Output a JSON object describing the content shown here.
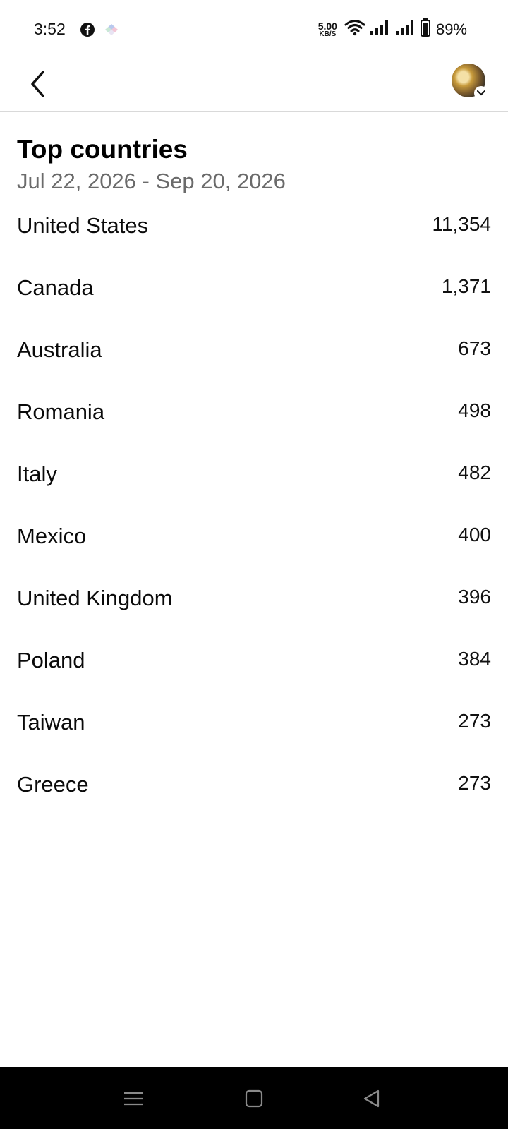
{
  "status_bar": {
    "time": "3:52",
    "net_speed_value": "5.00",
    "net_speed_unit": "KB/S",
    "battery_percent": "89%"
  },
  "header": {
    "back_icon": "chevron-left-icon",
    "avatar_icon": "profile-avatar"
  },
  "page": {
    "title": "Top countries",
    "date_range": "Jul 22, 2026 - Sep 20, 2026"
  },
  "countries": [
    {
      "name": "United States",
      "value": "11,354"
    },
    {
      "name": "Canada",
      "value": "1,371"
    },
    {
      "name": "Australia",
      "value": "673"
    },
    {
      "name": "Romania",
      "value": "498"
    },
    {
      "name": "Italy",
      "value": "482"
    },
    {
      "name": "Mexico",
      "value": "400"
    },
    {
      "name": "United Kingdom",
      "value": "396"
    },
    {
      "name": "Poland",
      "value": "384"
    },
    {
      "name": "Taiwan",
      "value": "273"
    },
    {
      "name": "Greece",
      "value": "273"
    }
  ],
  "nav": {
    "recents_icon": "menu-icon",
    "home_icon": "square-icon",
    "back_icon": "triangle-back-icon"
  }
}
